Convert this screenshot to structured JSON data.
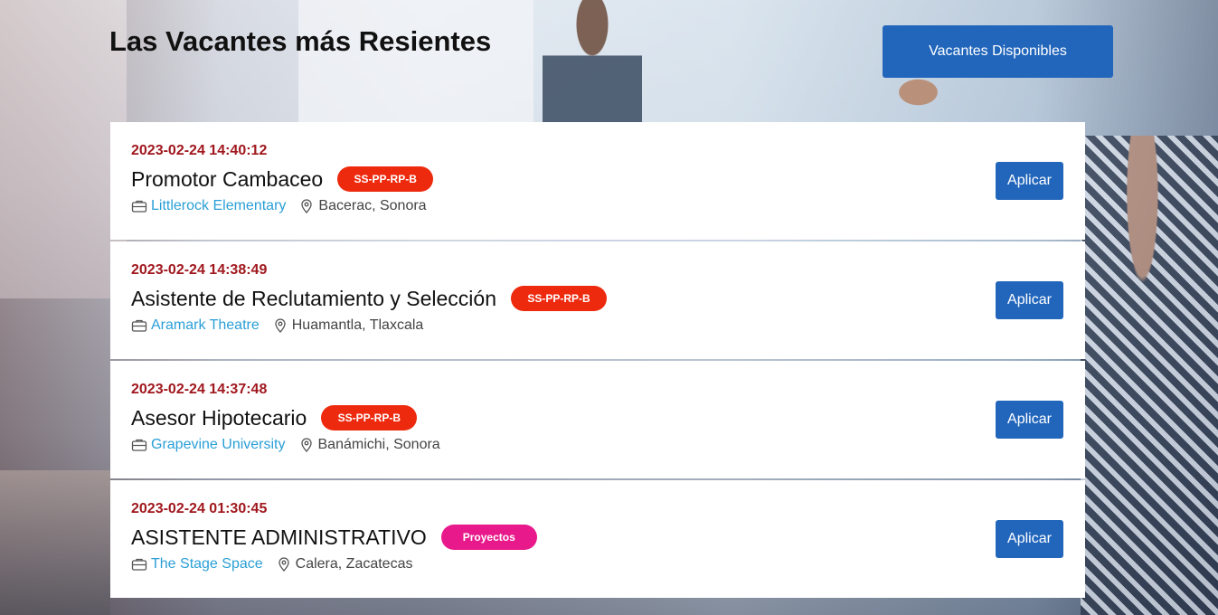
{
  "header": {
    "title": "Las Vacantes más Resientes",
    "vacancies_button": "Vacantes Disponibles"
  },
  "colors": {
    "primary": "#2266bb",
    "date": "#a0181e",
    "company_link": "#2a9fd6"
  },
  "jobs": [
    {
      "date": "2023-02-24 14:40:12",
      "title": "Promotor Cambaceo",
      "badge": "SS-PP-RP-B",
      "badge_color": "#ee2a0e",
      "company": "Littlerock Elementary",
      "location": "Bacerac, Sonora",
      "apply": "Aplicar"
    },
    {
      "date": "2023-02-24 14:38:49",
      "title": "Asistente de Reclutamiento y Selección",
      "badge": "SS-PP-RP-B",
      "badge_color": "#ee2a0e",
      "company": "Aramark Theatre",
      "location": "Huamantla, Tlaxcala",
      "apply": "Aplicar"
    },
    {
      "date": "2023-02-24 14:37:48",
      "title": "Asesor Hipotecario",
      "badge": "SS-PP-RP-B",
      "badge_color": "#ee2a0e",
      "company": "Grapevine University",
      "location": "Banámichi, Sonora",
      "apply": "Aplicar"
    },
    {
      "date": "2023-02-24 01:30:45",
      "title": "ASISTENTE ADMINISTRATIVO",
      "badge": "Proyectos",
      "badge_color": "#e8198b",
      "company": "The Stage Space",
      "location": "Calera, Zacatecas",
      "apply": "Aplicar"
    }
  ],
  "icons": {
    "company": "briefcase-icon",
    "location": "map-pin-icon"
  }
}
